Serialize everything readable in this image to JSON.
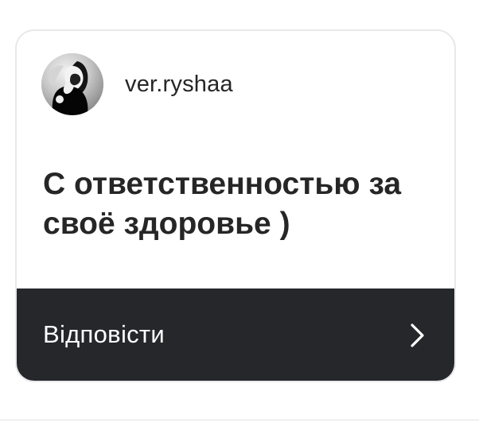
{
  "story_reply": {
    "username": "ver.ryshaa",
    "message": "С ответственностью за своё здоровье )",
    "reply_label": "Відповісти"
  },
  "icons": {
    "avatar": "user-avatar-photo",
    "reply_arrow": "chevron-right-icon"
  },
  "colors": {
    "card_background": "#ffffff",
    "card_border": "#e8e8ea",
    "reply_bar_background": "#26272b",
    "text_primary": "#262626",
    "reply_text": "#ffffff"
  }
}
